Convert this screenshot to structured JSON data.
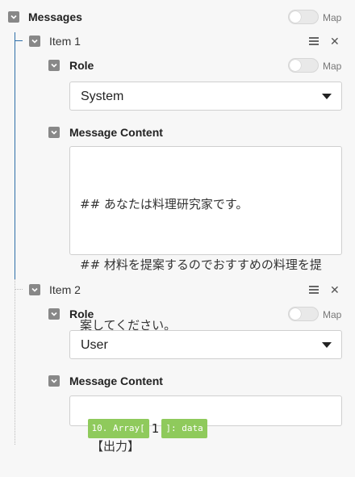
{
  "messages": {
    "title": "Messages",
    "map_label": "Map",
    "items": [
      {
        "title": "Item 1",
        "role_label": "Role",
        "role_map_label": "Map",
        "role_value": "System",
        "content_label": "Message Content",
        "content_lines": [
          "## あなたは料理研究家です。",
          "## 材料を提案するのでおすすめの料理を提",
          "案してください。",
          "",
          "【出力】"
        ]
      },
      {
        "title": "Item 2",
        "role_label": "Role",
        "role_map_label": "Map",
        "role_value": "User",
        "content_label": "Message Content",
        "content_tag_left": "10. Array[",
        "content_index": "1",
        "content_tag_right": "]: data"
      }
    ]
  },
  "icons": {
    "collapse": "chevron-down-icon",
    "menu": "hamburger-menu-icon",
    "close": "close-icon",
    "dropdown": "caret-down-icon"
  },
  "colors": {
    "tree_line": "#2f6fa8",
    "tag_green": "#8fca5c",
    "chevron_gray": "#888888"
  }
}
